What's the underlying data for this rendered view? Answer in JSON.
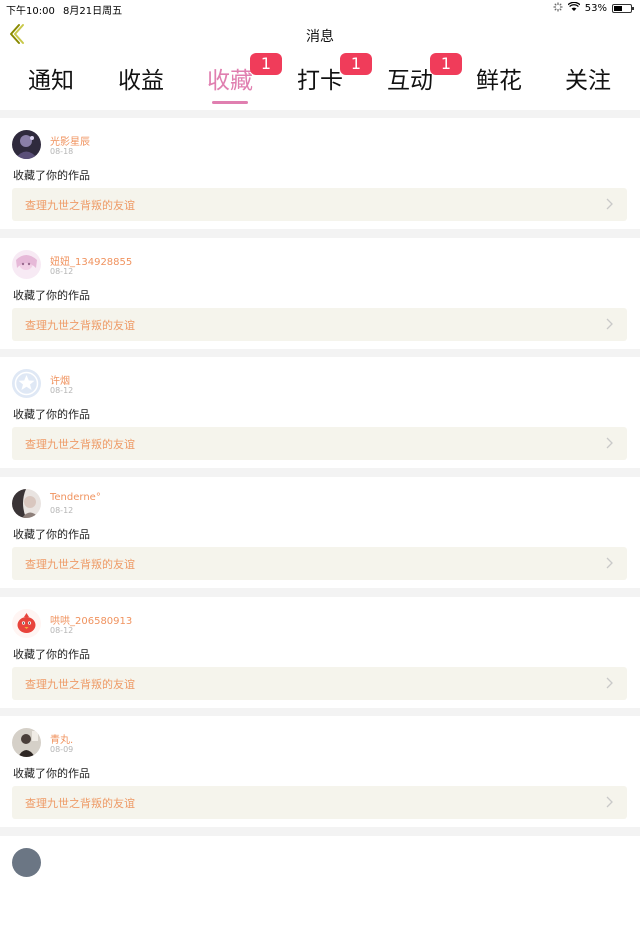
{
  "status_bar": {
    "time": "下午10:00",
    "date": "8月21日周五",
    "battery": "53%",
    "battery_level": 0.53
  },
  "nav": {
    "title": "消息",
    "back_icon": "chevron-left-icon"
  },
  "tabs": [
    {
      "label": "通知",
      "active": false,
      "badge": ""
    },
    {
      "label": "收益",
      "active": false,
      "badge": ""
    },
    {
      "label": "收藏",
      "active": true,
      "badge": "1"
    },
    {
      "label": "打卡",
      "active": false,
      "badge": "1"
    },
    {
      "label": "互动",
      "active": false,
      "badge": "1"
    },
    {
      "label": "鲜花",
      "active": false,
      "badge": ""
    },
    {
      "label": "关注",
      "active": false,
      "badge": ""
    }
  ],
  "colors": {
    "accent": "#e07fb0",
    "badge": "#f03c5a",
    "username": "#f0935f",
    "work_title": "#ee9a66",
    "work_bg": "#f5f4ec"
  },
  "items": [
    {
      "username": "光影星辰",
      "date": "08-18",
      "action": "收藏了你的作品",
      "work_title": "查理九世之背叛的友谊",
      "avatar": "avatar-dark"
    },
    {
      "username": "妞妞_134928855",
      "date": "08-12",
      "action": "收藏了你的作品",
      "work_title": "查理九世之背叛的友谊",
      "avatar": "avatar-pink-anime"
    },
    {
      "username": "许烟",
      "date": "08-12",
      "action": "收藏了你的作品",
      "work_title": "查理九世之背叛的友谊",
      "avatar": "avatar-default-star"
    },
    {
      "username": "Tenderne°",
      "date": "08-12",
      "action": "收藏了你的作品",
      "work_title": "查理九世之背叛的友谊",
      "avatar": "avatar-portrait"
    },
    {
      "username": "哄哄_206580913",
      "date": "08-12",
      "action": "收藏了你的作品",
      "work_title": "查理九世之背叛的友谊",
      "avatar": "avatar-red-bird"
    },
    {
      "username": "青丸.",
      "date": "08-09",
      "action": "收藏了你的作品",
      "work_title": "查理九世之背叛的友谊",
      "avatar": "avatar-photo"
    }
  ]
}
